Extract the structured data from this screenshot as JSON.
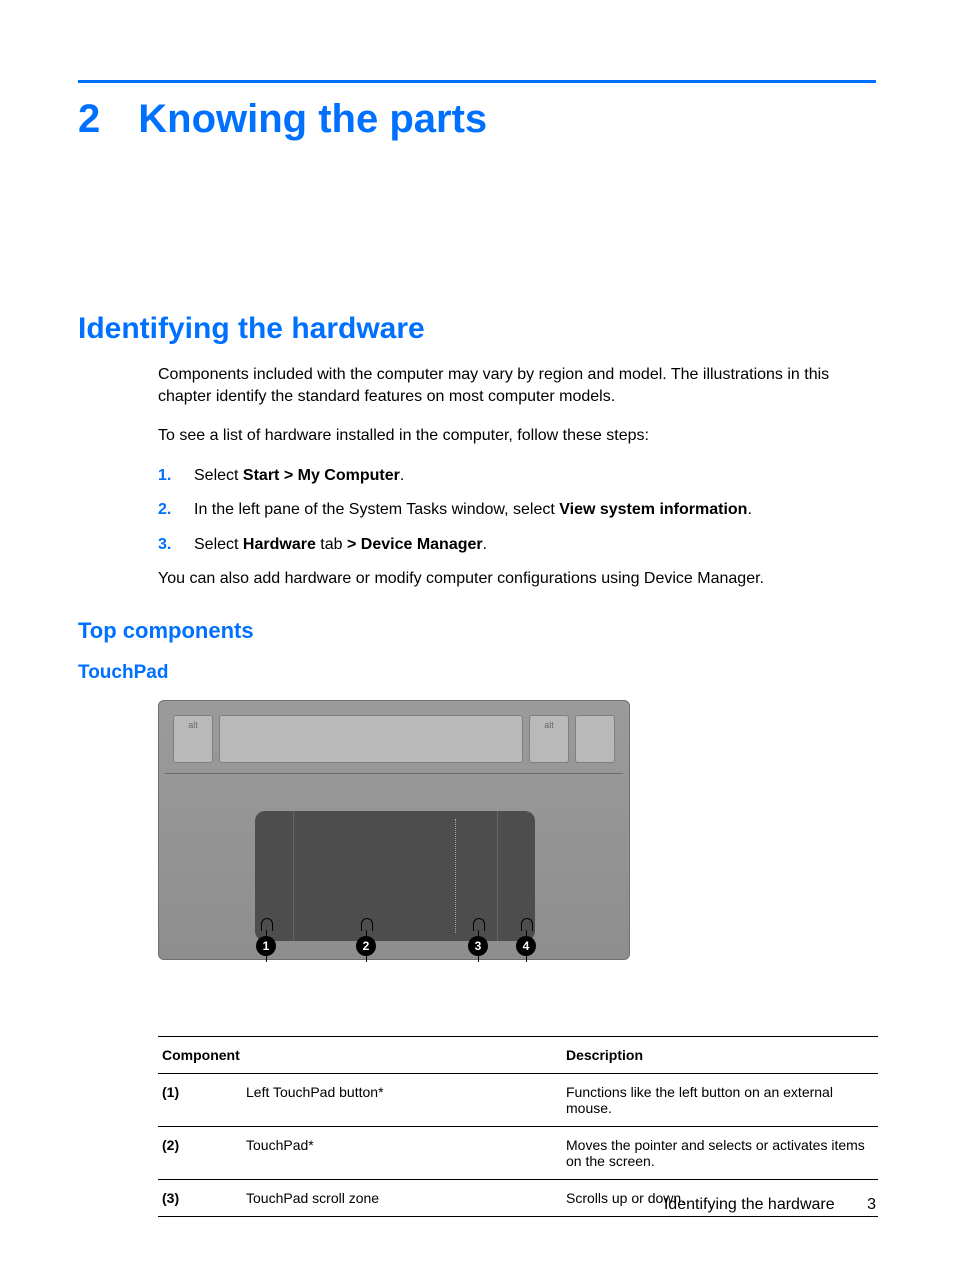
{
  "chapter": {
    "number": "2",
    "title": "Knowing the parts"
  },
  "section": {
    "h2": "Identifying the hardware",
    "intro": "Components included with the computer may vary by region and model. The illustrations in this chapter identify the standard features on most computer models.",
    "lead": "To see a list of hardware installed in the computer, follow these steps:",
    "steps": {
      "s1_pre": "Select ",
      "s1_bold": "Start > My Computer",
      "s1_post": ".",
      "s2_pre": "In the left pane of the System Tasks window, select ",
      "s2_bold": "View system information",
      "s2_post": ".",
      "s3_pre": "Select ",
      "s3_bold1": "Hardware",
      "s3_mid": " tab ",
      "s3_bold2": "> Device Manager",
      "s3_post": "."
    },
    "note": "You can also add hardware or modify computer configurations using Device Manager."
  },
  "sub": {
    "h3": "Top components",
    "h4": "TouchPad"
  },
  "figure": {
    "key_alt_left": "alt",
    "key_alt_right": "alt",
    "callouts": {
      "c1": "1",
      "c2": "2",
      "c3": "3",
      "c4": "4"
    }
  },
  "table": {
    "headers": {
      "component": "Component",
      "description": "Description"
    },
    "rows": [
      {
        "id": "(1)",
        "name": "Left TouchPad button*",
        "desc": "Functions like the left button on an external mouse."
      },
      {
        "id": "(2)",
        "name": "TouchPad*",
        "desc": "Moves the pointer and selects or activates items on the screen."
      },
      {
        "id": "(3)",
        "name": "TouchPad scroll zone",
        "desc": "Scrolls up or down."
      }
    ]
  },
  "footer": {
    "section": "Identifying the hardware",
    "page": "3"
  }
}
